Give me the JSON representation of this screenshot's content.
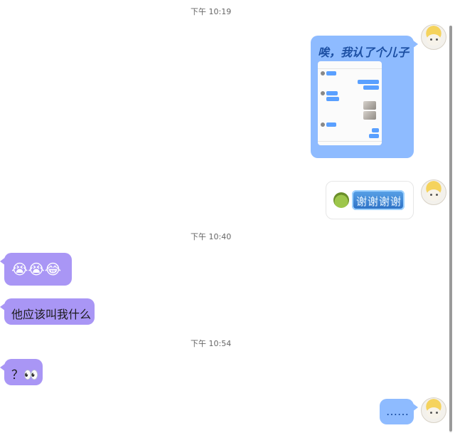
{
  "timestamps": {
    "t1": "下午 10:19",
    "t2": "下午 10:40",
    "t3": "下午 10:54"
  },
  "messages": {
    "m1_text": "唉，我认了个儿子",
    "m2_sticker_text": "谢谢谢谢",
    "m2_sticker_subtext": "谢谢",
    "m3_text": "😭😭😂",
    "m4_text": "他应该叫我什么",
    "m5_text": "？👀",
    "m6_text": "……"
  },
  "colors": {
    "sent_bubble": "#8ebbff",
    "received_bubble": "#a996f5",
    "background": "#ffffff"
  },
  "icons": {
    "avatar": "cat-avatar-icon"
  }
}
